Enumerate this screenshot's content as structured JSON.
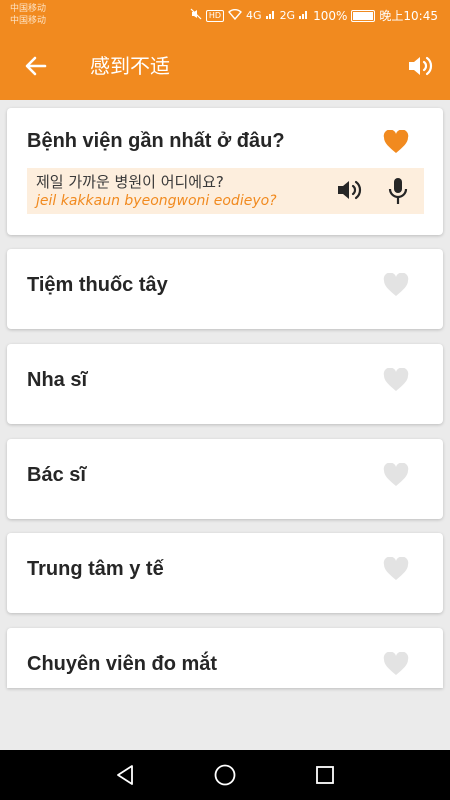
{
  "status_bar": {
    "carrier_1": "中国移动",
    "carrier_2": "中国移动",
    "hd_label": "HD",
    "signal_1": "4G",
    "signal_2": "2G",
    "battery_text": "100%",
    "time": "晚上10:45"
  },
  "app_bar": {
    "title": "感到不适",
    "back_icon": "arrow-left-icon",
    "speaker_icon": "volume-icon"
  },
  "phrases": [
    {
      "title": "Bệnh viện gần nhất ở đâu?",
      "favorite": true,
      "expanded": true,
      "korean": "제일 가까운 병원이 어디에요?",
      "romanization": "jeil kakkaun byeongwoni eodieyo?"
    },
    {
      "title": "Tiệm thuốc tây",
      "favorite": false
    },
    {
      "title": "Nha sĩ",
      "favorite": false
    },
    {
      "title": "Bác sĩ",
      "favorite": false
    },
    {
      "title": "Trung tâm y tế",
      "favorite": false
    },
    {
      "title": "Chuyên viên đo mắt",
      "favorite": false
    }
  ],
  "colors": {
    "accent": "#f18a1f",
    "heart_active": "#f18a1f",
    "heart_inactive": "#e3e3e3",
    "phrase_box_bg": "#fdeedd",
    "background": "#ebebeb"
  },
  "nav_bar": {
    "back_icon": "triangle-back-icon",
    "home_icon": "circle-home-icon",
    "recents_icon": "square-recents-icon"
  }
}
